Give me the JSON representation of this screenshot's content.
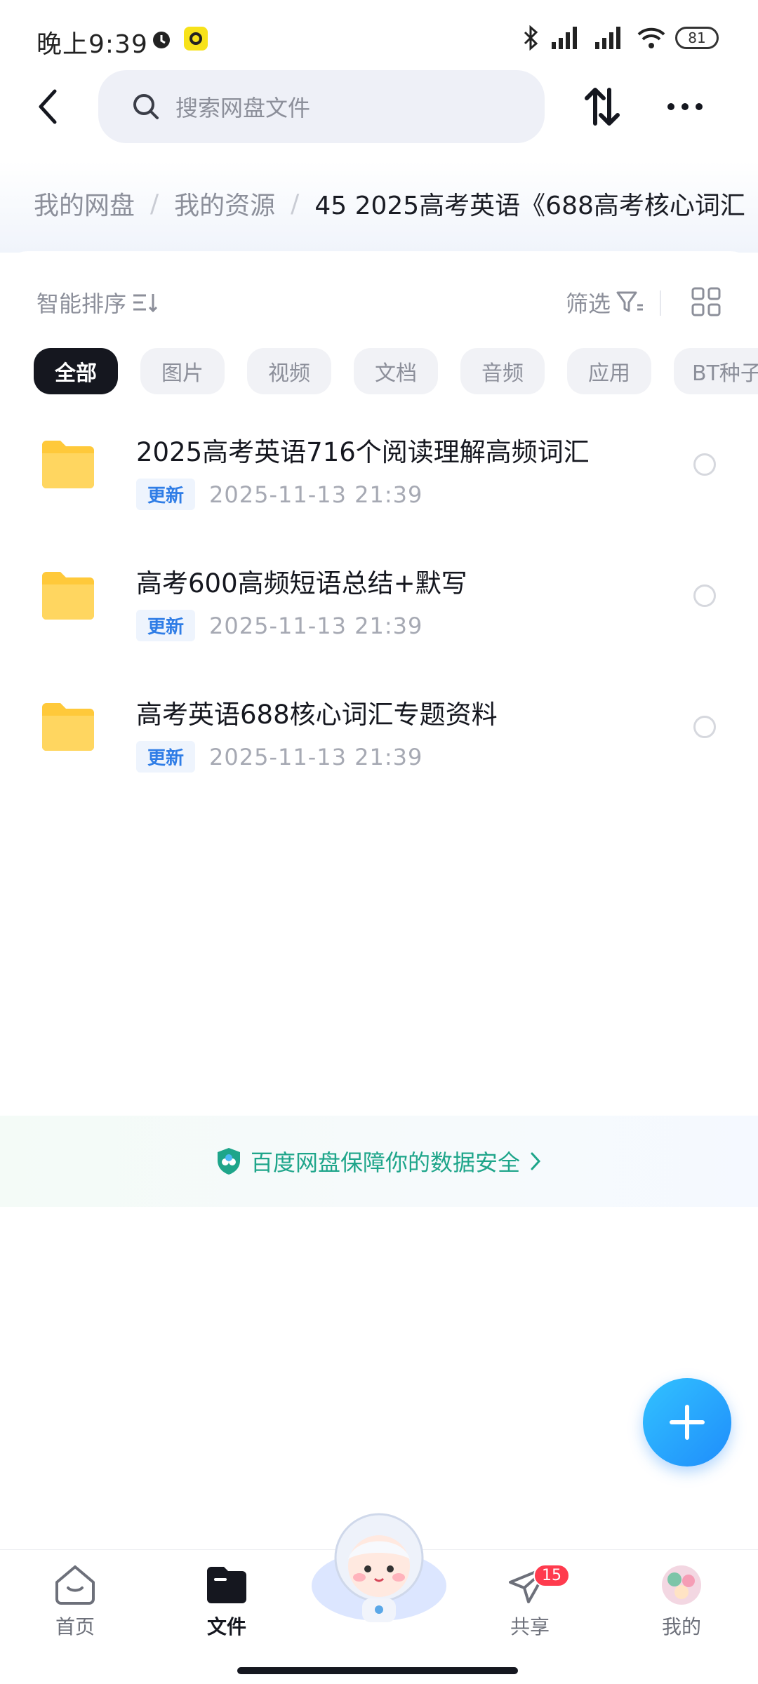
{
  "status_bar": {
    "time": "晚上9:39",
    "battery": "81"
  },
  "nav": {
    "search_placeholder": "搜索网盘文件"
  },
  "breadcrumb": {
    "items": [
      "我的网盘",
      "我的资源"
    ],
    "current": "45  2025高考英语《688高考核心词汇"
  },
  "toolbar": {
    "sort_label": "智能排序",
    "filter_label": "筛选"
  },
  "chips": [
    "全部",
    "图片",
    "视频",
    "文档",
    "音频",
    "应用",
    "BT种子"
  ],
  "files": [
    {
      "name": "2025高考英语716个阅读理解高频词汇",
      "tag": "更新",
      "date": "2025-11-13  21:39"
    },
    {
      "name": "高考600高频短语总结+默写",
      "tag": "更新",
      "date": "2025-11-13  21:39"
    },
    {
      "name": "高考英语688核心词汇专题资料",
      "tag": "更新",
      "date": "2025-11-13  21:39"
    }
  ],
  "security_text": "百度网盘保障你的数据安全",
  "bottom_nav": {
    "home": "首页",
    "files": "文件",
    "share": "共享",
    "share_badge": "15",
    "me": "我的"
  },
  "colors": {
    "accent": "#1f8dfb",
    "folder": "#ffc93a",
    "security": "#1ea58a",
    "badge": "#ff3b4e"
  }
}
